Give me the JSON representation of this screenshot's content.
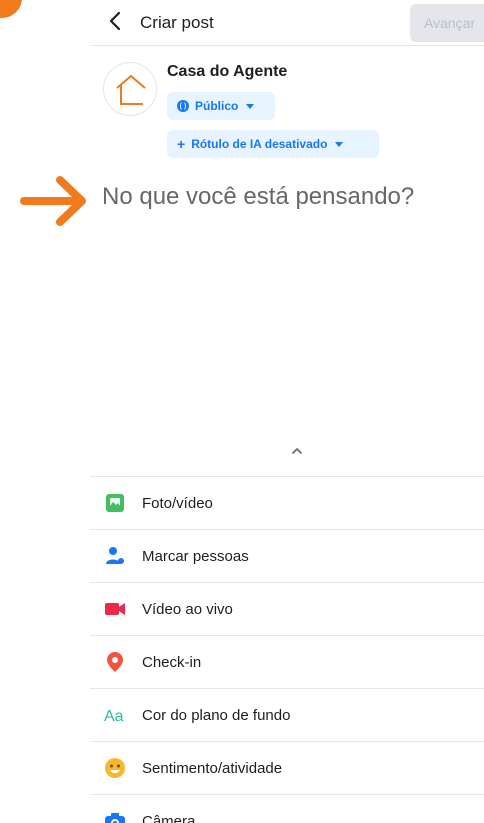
{
  "header": {
    "title": "Criar post",
    "next_label": "Avançar"
  },
  "author": {
    "name": "Casa do Agente",
    "audience_label": "Público",
    "ai_label": "Rótulo de IA desativado",
    "ai_prefix": "+"
  },
  "composer": {
    "placeholder": "No que você está pensando?"
  },
  "options": [
    {
      "label": "Foto/vídeo",
      "icon": "photo-icon",
      "color": "#45bd62"
    },
    {
      "label": "Marcar pessoas",
      "icon": "tag-people-icon",
      "color": "#1877f2"
    },
    {
      "label": "Vídeo ao vivo",
      "icon": "live-video-icon",
      "color": "#f02849"
    },
    {
      "label": "Check-in",
      "icon": "location-pin-icon",
      "color": "#f5533d"
    },
    {
      "label": "Cor do plano de fundo",
      "icon": "background-color-icon",
      "color": "#2abba7"
    },
    {
      "label": "Sentimento/atividade",
      "icon": "feeling-icon",
      "color": "#f7b928"
    },
    {
      "label": "Câmera",
      "icon": "camera-icon",
      "color": "#1877f2"
    }
  ],
  "colors": {
    "accent": "#1877f2",
    "annotation": "#f07a1c"
  }
}
